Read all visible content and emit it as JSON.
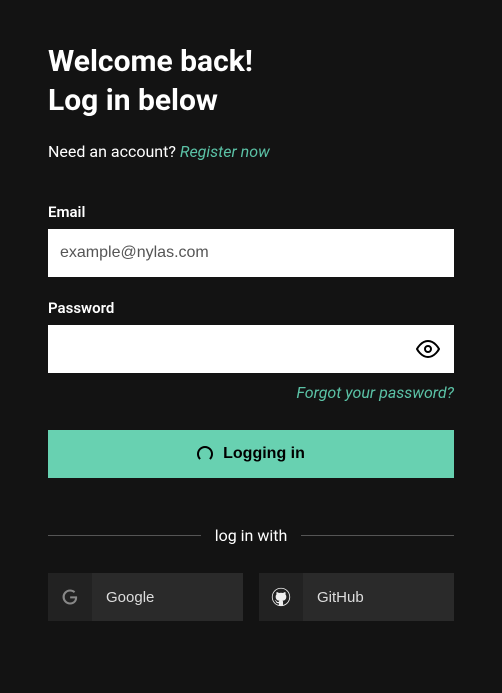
{
  "title_line1": "Welcome back!",
  "title_line2": "Log in below",
  "register": {
    "prompt": "Need an account? ",
    "link": "Register now"
  },
  "email": {
    "label": "Email",
    "placeholder": "example@nylas.com",
    "value": ""
  },
  "password": {
    "label": "Password",
    "value": ""
  },
  "forgot": "Forgot your password?",
  "login_button": "Logging in",
  "divider": "log in with",
  "social": {
    "google": "Google",
    "github": "GitHub"
  },
  "colors": {
    "accent": "#68d1b1",
    "link": "#5bc2a6",
    "bg": "#131313",
    "socialBg": "#2a2a2a"
  }
}
